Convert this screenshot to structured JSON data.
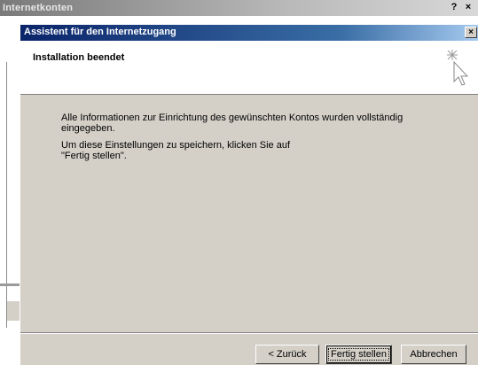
{
  "background_window": {
    "title": "Internetkonten",
    "help_label": "?",
    "close_label": "×"
  },
  "dialog": {
    "title": "Assistent für den Internetzugang",
    "close_label": "×",
    "header_title": "Installation beendet",
    "header_icon": "cursor-sparkle-icon",
    "paragraph1": "Alle Informationen zur Einrichtung des gewünschten Kontos wurden vollständig eingegeben.",
    "paragraph2_line1": "Um diese Einstellungen zu speichern, klicken Sie auf",
    "paragraph2_line2": "\"Fertig stellen\".",
    "buttons": {
      "back": "< Zurück",
      "finish": "Fertig stellen",
      "cancel": "Abbrechen"
    }
  },
  "colors": {
    "dialog_face": "#d4d0c8",
    "active_title_start": "#0a246a",
    "active_title_end": "#a6caf0",
    "inactive_title": "#7a7a7a"
  }
}
